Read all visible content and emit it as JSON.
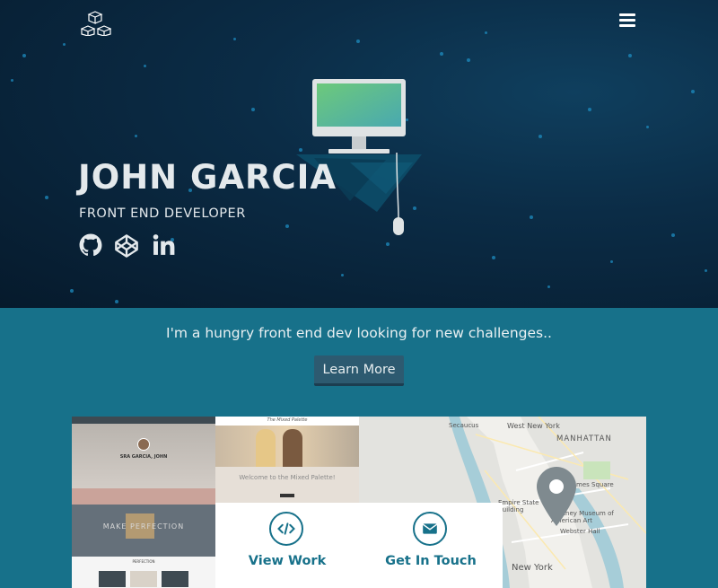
{
  "header": {
    "logo": "logo-cubes-icon",
    "menu": "hamburger-menu-icon"
  },
  "hero": {
    "name": "JOHN GARCIA",
    "title": "FRONT END DEVELOPER",
    "social": [
      "github-icon",
      "codepen-icon",
      "linkedin-icon"
    ]
  },
  "intro": {
    "tagline": "I'm a hungry front end dev looking for new challenges..",
    "cta": "Learn More"
  },
  "preview": {
    "site1": {
      "title": "SRA GARCIA, JOHN",
      "band": "MAKE PERFECTION",
      "footer": "PERFECTION"
    },
    "site2": {
      "title": "The Mixed Palette",
      "welcome": "Welcome to the Mixed Palette!"
    },
    "map": {
      "labels": [
        "West New York",
        "MANHATTAN",
        "Secaucus",
        "Times Square",
        "Empire State Building",
        "Whitney Museum of American Art",
        "Webster Hall",
        "New York"
      ]
    }
  },
  "cards": [
    {
      "label": "View Work",
      "icon": "code-icon"
    },
    {
      "label": "Get In Touch",
      "icon": "envelope-icon"
    }
  ],
  "colors": {
    "accent": "#17718a",
    "hero_bg": "#0b2c46",
    "button": "#2d5a70"
  }
}
